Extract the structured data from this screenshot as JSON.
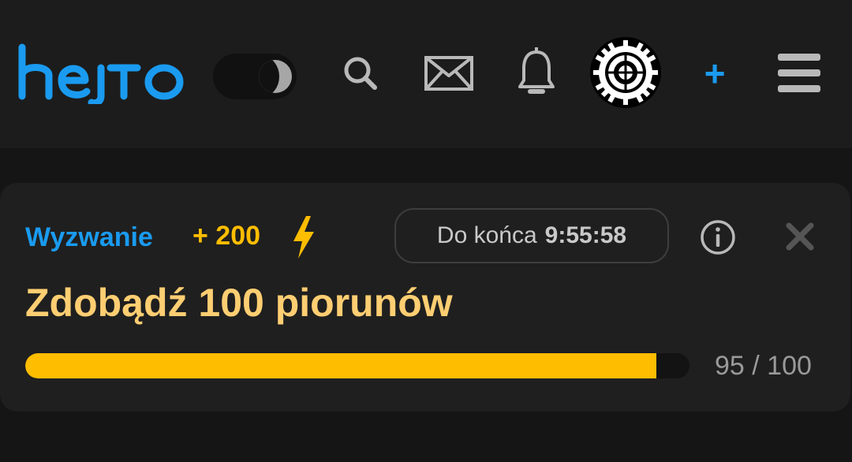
{
  "header": {
    "logo_text": "hejto",
    "theme_toggle": {
      "mode": "dark",
      "icon": "moon-icon"
    },
    "icons": [
      "search-icon",
      "mail-icon",
      "bell-icon",
      "avatar-gear",
      "plus-icon",
      "menu-icon"
    ],
    "add_label": "+"
  },
  "challenge": {
    "label": "Wyzwanie",
    "reward": "+ 200",
    "reward_icon": "lightning-icon",
    "timer_label": "Do końca",
    "timer_value": "9:55:58",
    "title": "Zdobądź 100 piorunów",
    "progress_current": 95,
    "progress_total": 100,
    "progress_text": "95 / 100"
  },
  "colors": {
    "accent_blue": "#1a9bf0",
    "accent_yellow": "#ffbd00",
    "title_color": "#ffce72",
    "background": "#151515",
    "card": "#1f1f1f"
  }
}
